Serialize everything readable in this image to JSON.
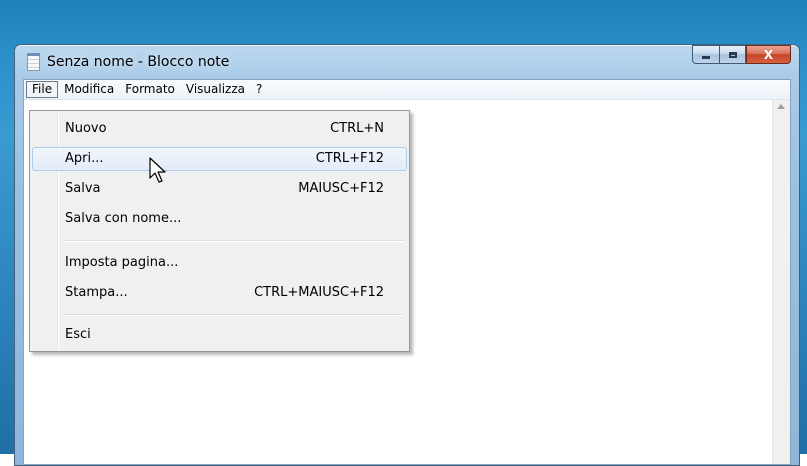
{
  "window": {
    "title": "Senza nome - Blocco note"
  },
  "caption_buttons": {
    "minimize_icon": "minimize-icon",
    "maximize_icon": "maximize-icon",
    "close_label": "X"
  },
  "menubar": {
    "items": [
      {
        "label": "File",
        "active": true
      },
      {
        "label": "Modifica"
      },
      {
        "label": "Formato"
      },
      {
        "label": "Visualizza"
      },
      {
        "label": "?"
      }
    ]
  },
  "file_menu": {
    "items": [
      {
        "label": "Nuovo",
        "shortcut": "CTRL+N"
      },
      {
        "label": "Apri...",
        "shortcut": "CTRL+F12",
        "hovered": true
      },
      {
        "label": "Salva",
        "shortcut": "MAIUSC+F12"
      },
      {
        "label": "Salva con nome...",
        "shortcut": ""
      },
      {
        "label": "Imposta pagina...",
        "shortcut": ""
      },
      {
        "label": "Stampa...",
        "shortcut": "CTRL+MAIUSC+F12"
      },
      {
        "label": "Esci",
        "shortcut": ""
      }
    ]
  },
  "colors": {
    "hover_border": "#aeccee",
    "close_button": "#c7452a",
    "title_bar": "#a9cbe8"
  }
}
